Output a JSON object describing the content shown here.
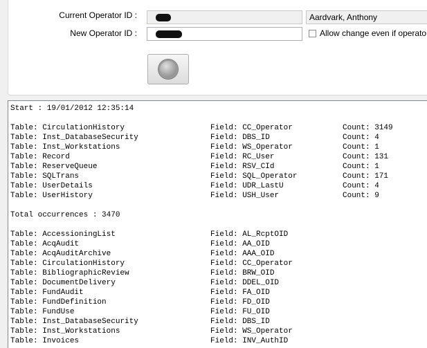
{
  "form": {
    "current_operator_label": "Current Operator ID :",
    "current_operator_name": "Aardvark, Anthony",
    "new_operator_label": "New Operator ID :",
    "allow_change_label": "Allow change even if operator no"
  },
  "log": {
    "start_line": "Start : 19/01/2012 12:35:14",
    "occurrences": [
      {
        "table": "Table: CirculationHistory",
        "field": "Field: CC_Operator",
        "count": "Count: 3149"
      },
      {
        "table": "Table: Inst_DatabaseSecurity",
        "field": "Field: DBS_ID",
        "count": "Count: 4"
      },
      {
        "table": "Table: Inst_Workstations",
        "field": "Field: WS_Operator",
        "count": "Count: 1"
      },
      {
        "table": "Table: Record",
        "field": "Field: RC_User",
        "count": "Count: 131"
      },
      {
        "table": "Table: ReserveQueue",
        "field": "Field: RSV_CId",
        "count": "Count: 1"
      },
      {
        "table": "Table: SQLTrans",
        "field": "Field: SQL_Operator",
        "count": "Count: 171"
      },
      {
        "table": "Table: UserDetails",
        "field": "Field: UDR_LastU",
        "count": "Count: 4"
      },
      {
        "table": "Table: UserHistory",
        "field": "Field: USH_User",
        "count": "Count: 9"
      }
    ],
    "total_line": "Total occurrences : 3470",
    "fields": [
      {
        "table": "Table: AccessioningList",
        "field": "Field: AL_RcptOID"
      },
      {
        "table": "Table: AcqAudit",
        "field": "Field: AA_OID"
      },
      {
        "table": "Table: AcqAuditArchive",
        "field": "Field: AAA_OID"
      },
      {
        "table": "Table: CirculationHistory",
        "field": "Field: CC_Operator"
      },
      {
        "table": "Table: BibliographicReview",
        "field": "Field: BRW_OID"
      },
      {
        "table": "Table: DocumentDelivery",
        "field": "Field: DDEL_OID"
      },
      {
        "table": "Table: FundAudit",
        "field": "Field: FA_OID"
      },
      {
        "table": "Table: FundDefinition",
        "field": "Field: FD_OID"
      },
      {
        "table": "Table: FundUse",
        "field": "Field: FU_OID"
      },
      {
        "table": "Table: Inst_DatabaseSecurity",
        "field": "Field: DBS_ID"
      },
      {
        "table": "Table: Inst_Workstations",
        "field": "Field: WS_Operator"
      },
      {
        "table": "Table: Invoices",
        "field": "Field: INV_AuthID"
      }
    ]
  }
}
